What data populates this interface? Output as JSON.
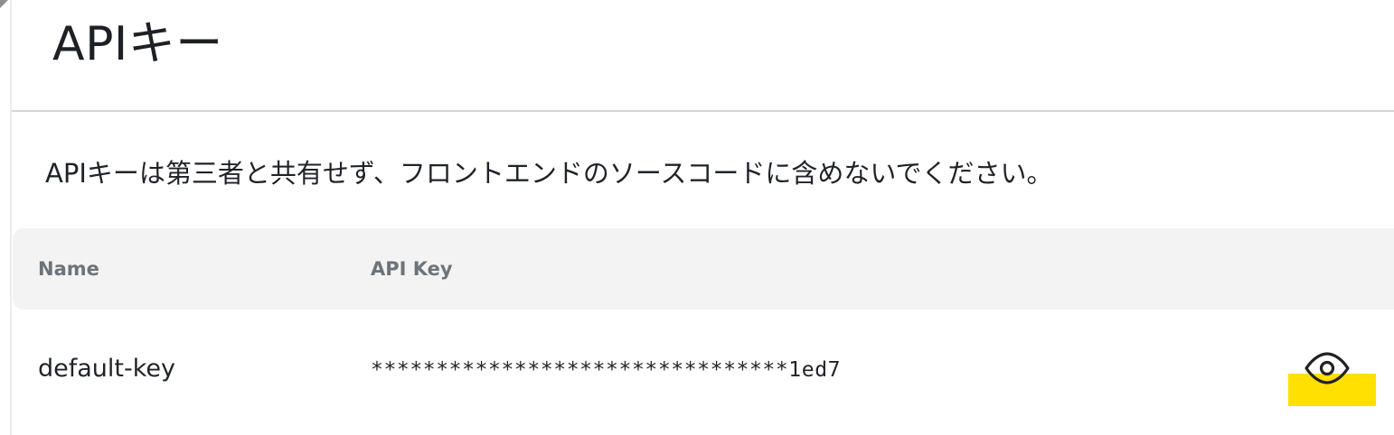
{
  "page": {
    "title": "APIキー",
    "notice": "APIキーは第三者と共有せず、フロントエンドのソースコードに含めないでください。"
  },
  "table": {
    "columns": [
      "Name",
      "API Key"
    ],
    "rows": [
      {
        "name": "default-key",
        "api_key": "********************************1ed7",
        "action_icon": "eye-icon"
      }
    ]
  },
  "colors": {
    "header_background": "#f3f3f3",
    "header_text": "#6e737a",
    "highlight": "#ffe000",
    "divider": "#d6d6d6"
  }
}
